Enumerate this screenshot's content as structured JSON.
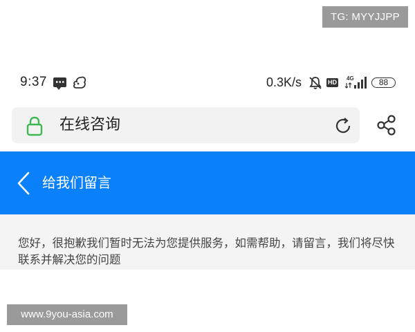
{
  "watermarks": {
    "top_right": "TG: MYYJJPP",
    "bottom_left": "www.9you-asia.com"
  },
  "status_bar": {
    "time": "9:37",
    "network_speed": "0.3K/s",
    "hd_badge": "HD",
    "network_type": "4G",
    "battery_level": "88",
    "icons": [
      "message-icon",
      "squirrel-icon",
      "mute-bell-icon",
      "signal-icon"
    ]
  },
  "address_bar": {
    "title": "在线咨询",
    "icons": [
      "lock-icon",
      "reload-icon"
    ],
    "lock_color": "#3cb853"
  },
  "share": {
    "icon": "share-icon"
  },
  "header": {
    "title": "给我们留言",
    "back_icon": "chevron-left-icon",
    "background": "#0a80fb"
  },
  "message": {
    "text": "您好，很抱歉我们暂时无法为您提供服务，如需帮助，请留言，我们将尽快联系并解决您的问题"
  }
}
